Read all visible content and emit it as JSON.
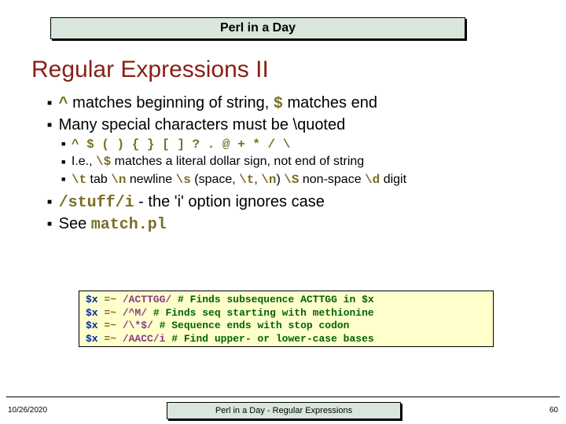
{
  "header": {
    "title": "Perl in a Day"
  },
  "slide": {
    "title": "Regular Expressions II"
  },
  "b1": {
    "caret": "^",
    "t1": " matches beginning of string, ",
    "dollar": "$",
    "t2": " matches end"
  },
  "b2": {
    "text": "Many special characters must be \\quoted"
  },
  "b2a": {
    "line": "^ $ ( ) { } [ ] ? . @ + * / \\"
  },
  "b2b": {
    "t1": "I.e., ",
    "m1": "\\$",
    "t2": " matches a literal dollar sign, not end of string"
  },
  "b2c": {
    "m1": "\\t",
    "t1": " tab ",
    "m2": "\\n",
    "t2": " newline ",
    "m3": "\\s",
    "t3": " (space, ",
    "m4": "\\t",
    "t4": ", ",
    "m5": "\\n",
    "t5": ") ",
    "m6": "\\S",
    "t6": " non-space ",
    "m7": "\\d",
    "t7": " digit"
  },
  "b3": {
    "m1": "/stuff/i",
    "t1": " - the 'i' option ignores case"
  },
  "b4": {
    "t1": "See ",
    "m1": "match.pl"
  },
  "code": {
    "l1": {
      "var": "$x",
      "op": " =~ ",
      "pat": "/ACTTGG/",
      "cmt": " # Finds subsequence ACTTGG in $x"
    },
    "l2": {
      "var": "$x",
      "op": " =~ ",
      "pat": "/^M/",
      "cmt": " # Finds seq starting with methionine"
    },
    "l3": {
      "var": "$x",
      "op": " =~ ",
      "pat": "/\\*$/",
      "cmt": " # Sequence ends with stop codon"
    },
    "l4": {
      "var": "$x",
      "op": " =~ ",
      "pat": "/AACC/i",
      "cmt": " # Find upper- or lower-case bases"
    }
  },
  "footer": {
    "date": "10/26/2020",
    "center": "Perl in a Day - Regular Expressions",
    "page": "60"
  }
}
